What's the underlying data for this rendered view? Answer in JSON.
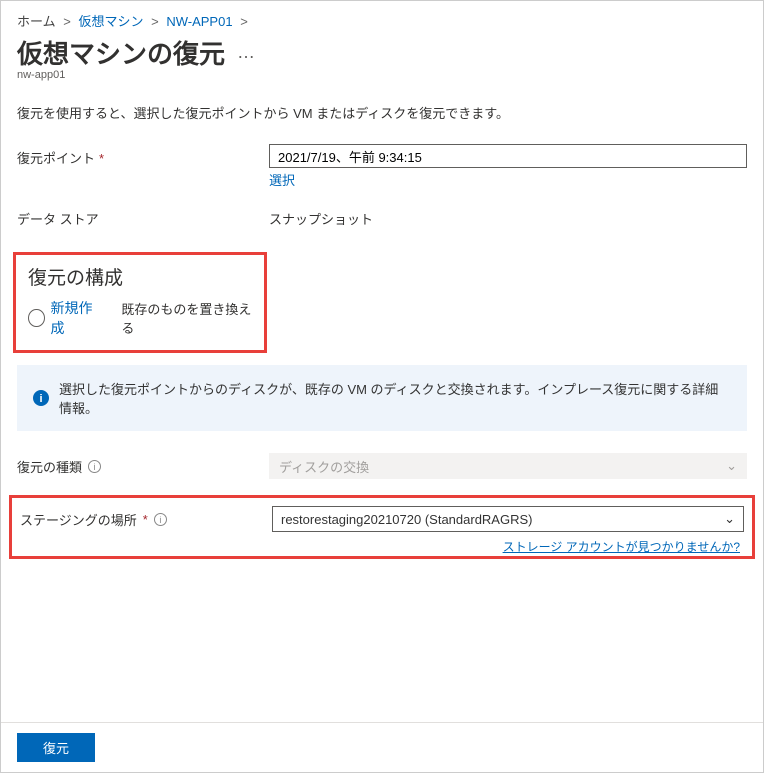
{
  "breadcrumb": {
    "home": "ホーム",
    "vm": "仮想マシン",
    "app": "NW-APP01"
  },
  "page": {
    "title": "仮想マシンの復元",
    "subtitle": "nw-app01",
    "ellipsis": "…",
    "description": "復元を使用すると、選択した復元ポイントから VM またはディスクを復元できます。"
  },
  "fields": {
    "restorePoint": {
      "label": "復元ポイント",
      "value": "2021/7/19、午前 9:34:15",
      "selectLink": "選択"
    },
    "datastore": {
      "label": "データ ストア",
      "value": "スナップショット"
    },
    "restoreType": {
      "label": "復元の種類",
      "value": "ディスクの交換"
    },
    "staging": {
      "label": "ステージングの場所",
      "value": "restorestaging20210720 (StandardRAGRS)",
      "helpLink": "ストレージ アカウントが見つかりませんか?"
    }
  },
  "restoreConfig": {
    "title": "復元の構成",
    "optNew": "新規作成",
    "optReplace": "既存のものを置き換える"
  },
  "infoBanner": "選択した復元ポイントからのディスクが、既存の VM のディスクと交換されます。インプレース復元に関する詳細情報。",
  "footer": {
    "restoreButton": "復元"
  }
}
